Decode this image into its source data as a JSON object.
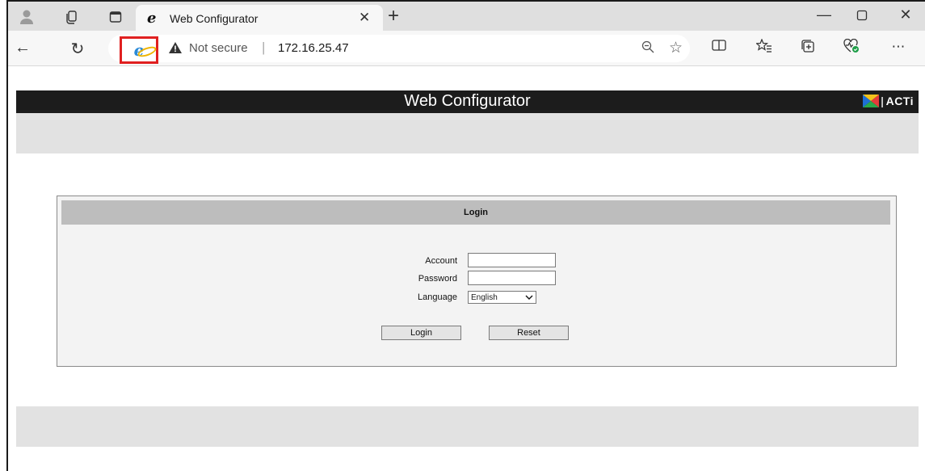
{
  "browser": {
    "tab_title": "Web Configurator",
    "security_label": "Not secure",
    "separator": "|",
    "url": "172.16.25.47",
    "icons": {
      "profile": "profile-icon",
      "workspaces": "workspaces-icon",
      "tab_actions": "tab-actions-icon",
      "tab_favicon": "ie-favicon",
      "tab_close": "close-icon",
      "new_tab": "plus-icon",
      "minimize": "minimize-icon",
      "maximize": "maximize-icon",
      "close_window": "close-icon",
      "back": "back-arrow-icon",
      "refresh": "refresh-icon",
      "ie_mode": "ie-mode-icon",
      "warning": "warning-icon",
      "zoom": "zoom-out-icon",
      "favorite": "star-icon",
      "split_screen": "split-screen-icon",
      "favorites": "favorites-icon",
      "collections": "collections-icon",
      "browser_essentials": "browser-essentials-icon",
      "more": "more-icon"
    },
    "highlight_color": "#e02020"
  },
  "page": {
    "header_title": "Web Configurator",
    "logo_text": "ACTi",
    "login": {
      "section_title": "Login",
      "account_label": "Account",
      "account_value": "",
      "password_label": "Password",
      "password_value": "",
      "language_label": "Language",
      "language_selected": "English",
      "login_button": "Login",
      "reset_button": "Reset"
    }
  }
}
